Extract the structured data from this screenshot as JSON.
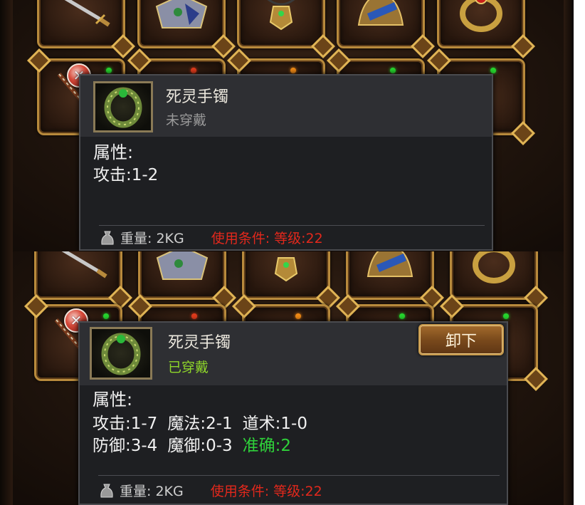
{
  "top_panel": {
    "slot_dots": [
      "green",
      "red",
      "orange",
      "red",
      "green"
    ],
    "tooltip": {
      "item_name": "死灵手镯",
      "status": "未穿戴",
      "status_color": "#9a9a9a",
      "attr_title": "属性:",
      "attr_lines": [
        [
          {
            "text": "攻击:1-2",
            "color": "#f1f1f1"
          }
        ]
      ],
      "weight": "重量: 2KG",
      "requirement": "使用条件: 等级:22"
    }
  },
  "bottom_panel": {
    "slot_dots": [
      "green",
      "red",
      "orange",
      "green",
      "green"
    ],
    "tooltip": {
      "item_name": "死灵手镯",
      "status": "已穿戴",
      "status_color": "#8fd62a",
      "unequip_label": "卸下",
      "attr_title": "属性:",
      "attr_lines": [
        [
          {
            "text": "攻击:1-7",
            "color": "#f1f1f1"
          },
          {
            "text": "魔法:2-1",
            "color": "#f1f1f1"
          },
          {
            "text": "道术:1-0",
            "color": "#f1f1f1"
          }
        ],
        [
          {
            "text": "防御:3-4",
            "color": "#f1f1f1"
          },
          {
            "text": "魔御:0-3",
            "color": "#f1f1f1"
          },
          {
            "text": "准确:2",
            "color": "#2fd13a"
          }
        ]
      ],
      "weight": "重量: 2KG",
      "requirement": "使用条件: 等级:22"
    }
  },
  "icons": {
    "row1": [
      "sword-icon",
      "armor-icon",
      "necklace-icon",
      "helmet-icon",
      "ring-icon"
    ],
    "row2": [
      "spear-icon",
      "bracelet-icon"
    ],
    "close": "close-icon",
    "bag": "weight-bag-icon"
  }
}
